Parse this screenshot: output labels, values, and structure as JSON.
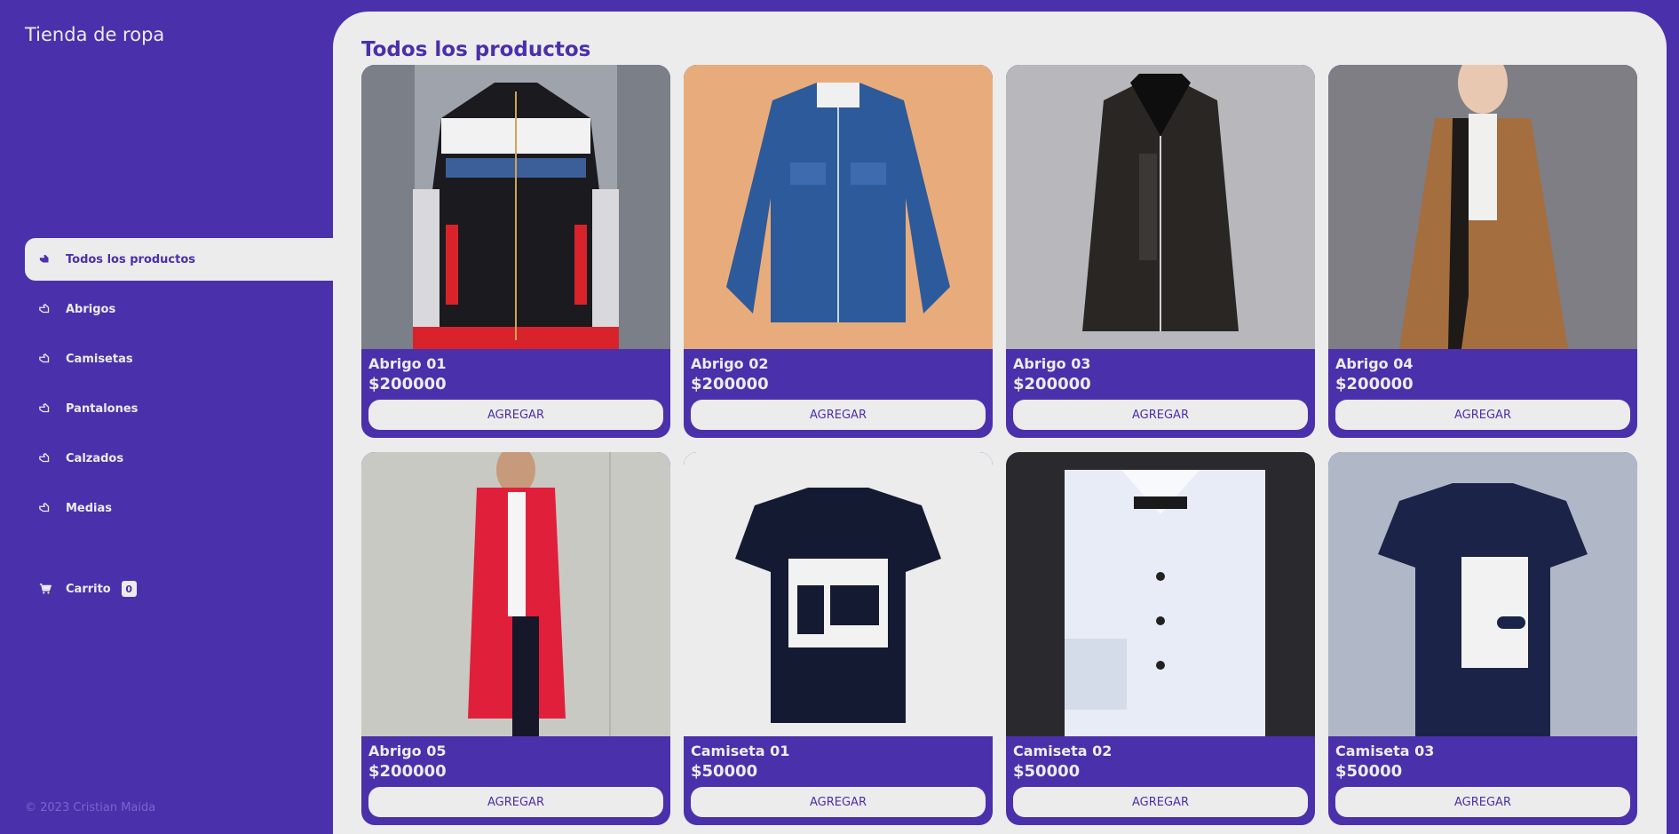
{
  "app": {
    "title": "Tienda de ropa"
  },
  "nav": {
    "items": [
      {
        "label": "Todos los productos",
        "active": true
      },
      {
        "label": "Abrigos"
      },
      {
        "label": "Camisetas"
      },
      {
        "label": "Pantalones"
      },
      {
        "label": "Calzados"
      },
      {
        "label": "Medias"
      }
    ]
  },
  "cart": {
    "label": "Carrito",
    "count": "0"
  },
  "footer": {
    "text": "© 2023 Cristian Maida"
  },
  "main": {
    "title": "Todos los productos"
  },
  "products": [
    {
      "name": "Abrigo 01",
      "price": "$200000",
      "button": "AGREGAR",
      "image": "jacket-black-white"
    },
    {
      "name": "Abrigo 02",
      "price": "$200000",
      "button": "AGREGAR",
      "image": "denim-jacket"
    },
    {
      "name": "Abrigo 03",
      "price": "$200000",
      "button": "AGREGAR",
      "image": "leather-jacket"
    },
    {
      "name": "Abrigo 04",
      "price": "$200000",
      "button": "AGREGAR",
      "image": "brown-coat"
    },
    {
      "name": "Abrigo 05",
      "price": "$200000",
      "button": "AGREGAR",
      "image": "red-puffer-coat"
    },
    {
      "name": "Camiseta 01",
      "price": "$50000",
      "button": "AGREGAR",
      "image": "navy-graphic-tee"
    },
    {
      "name": "Camiseta 02",
      "price": "$50000",
      "button": "AGREGAR",
      "image": "white-dress-shirt"
    },
    {
      "name": "Camiseta 03",
      "price": "$50000",
      "button": "AGREGAR",
      "image": "navy-tee"
    }
  ],
  "colors": {
    "brand": "#4b30ab",
    "surface": "#ececec",
    "footer": "#7a64cf"
  }
}
